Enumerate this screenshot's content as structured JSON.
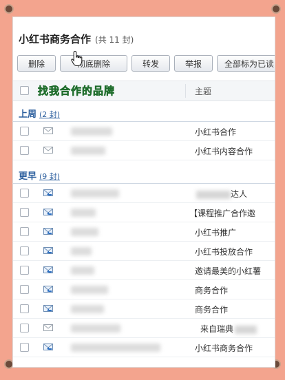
{
  "header": {
    "title": "小红书商务合作",
    "count": "(共 11 封)"
  },
  "toolbar": {
    "delete_label": "删除",
    "perm_delete_label": "彻底删除",
    "forward_label": "转发",
    "report_label": "举报",
    "mark_all_label": "全部标为已读"
  },
  "columns": {
    "subject": "主题"
  },
  "overlay_caption": "找我合作的品牌",
  "groups": [
    {
      "label": "上周",
      "count": "(2 封)"
    },
    {
      "label": "更早",
      "count": "(9 封)"
    }
  ],
  "rows_last_week": [
    {
      "subject": "小红书合作",
      "read": true
    },
    {
      "subject": "小红书内容合作",
      "read": true
    }
  ],
  "rows_earlier": [
    {
      "subject": "达人",
      "read": false
    },
    {
      "subject": "【课程推广合作邀",
      "read": false
    },
    {
      "subject": "小红书推广",
      "read": false
    },
    {
      "subject": "小红书投放合作",
      "read": false
    },
    {
      "subject": "邀请最美的小红薯",
      "read": false
    },
    {
      "subject": "商务合作",
      "read": false
    },
    {
      "subject": "商务合作",
      "read": false
    },
    {
      "subject": "来自瑞典",
      "read": true
    },
    {
      "subject": "小红书商务合作",
      "read": false
    }
  ],
  "colors": {
    "accent": "#2c5f9e",
    "caption": "#57d36a",
    "background": "#f3a48e"
  }
}
